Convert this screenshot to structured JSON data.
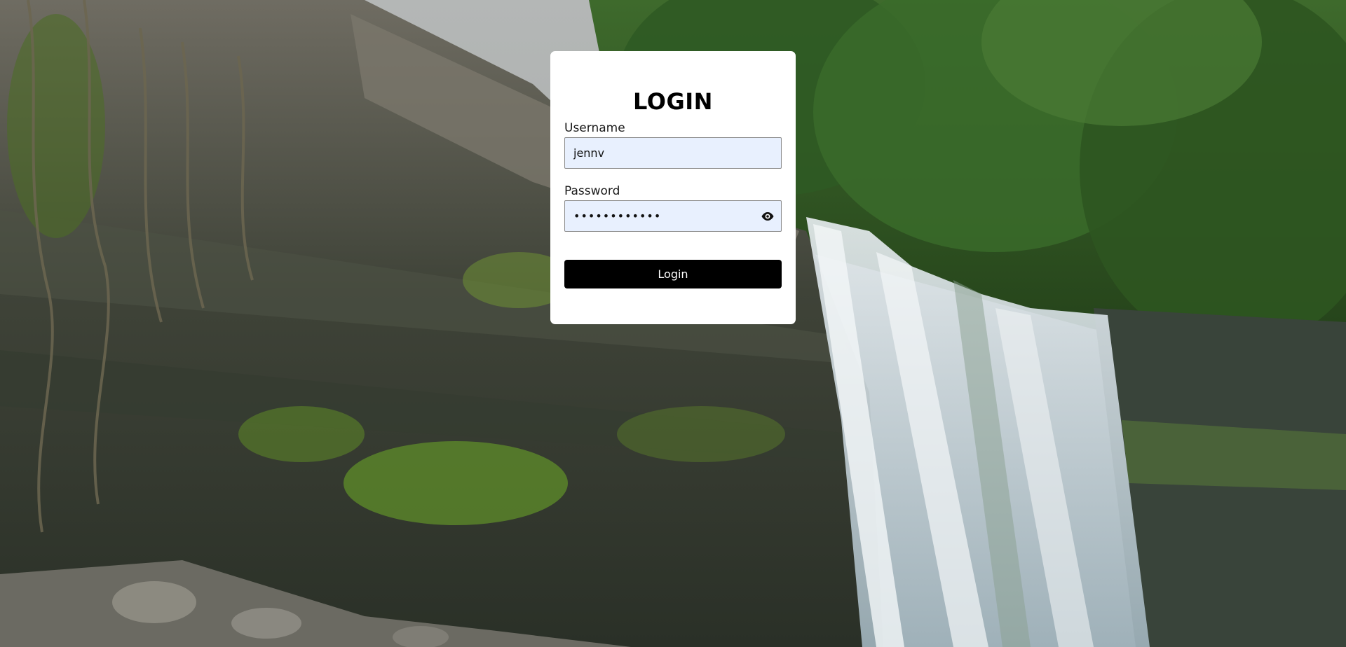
{
  "page": {
    "background": "waterfall-cliff-photo"
  },
  "login": {
    "title": "LOGIN",
    "username_label": "Username",
    "username_value": "jennv",
    "password_label": "Password",
    "password_value": "••••••••••••",
    "password_toggle_icon": "eye-icon",
    "button_label": "Login"
  },
  "colors": {
    "card": "#ffffff",
    "input_bg": "#e8f0fe",
    "button_bg": "#000000",
    "button_text": "#ffffff"
  }
}
